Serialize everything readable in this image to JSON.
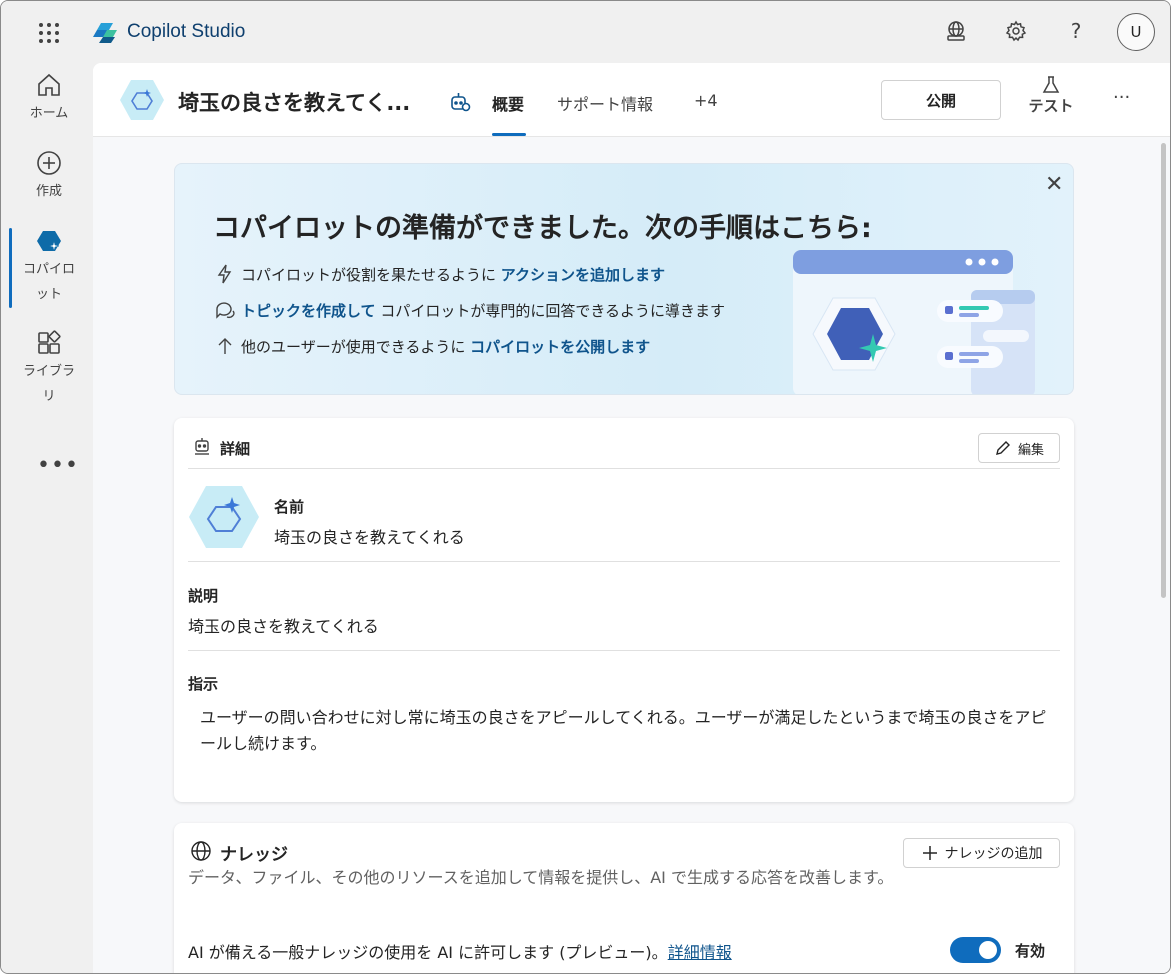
{
  "app": {
    "brand_name": "Copilot Studio",
    "avatar_initial": "U"
  },
  "rail": {
    "items": [
      {
        "label": "ホーム",
        "icon": "home-icon"
      },
      {
        "label": "作成",
        "icon": "add-circle-icon"
      },
      {
        "label": "コパイロット",
        "icon": "copilot-hex-icon",
        "active": true
      },
      {
        "label": "ライブラリ",
        "icon": "library-icon"
      }
    ],
    "more": "•••"
  },
  "header": {
    "title": "埼玉の良さを教えてく...",
    "tabs": [
      {
        "label": "概要",
        "active": true
      },
      {
        "label": "サポート情報"
      },
      {
        "label": "+4"
      }
    ],
    "publish_label": "公開",
    "test_label": "テスト",
    "more": "···"
  },
  "banner": {
    "title": "コパイロットの準備ができました。次の手順はこちら:",
    "steps": [
      {
        "pre": "コパイロットが役割を果たせるように ",
        "link": "アクションを追加します",
        "post": "",
        "icon": "flash-icon"
      },
      {
        "pre": "",
        "link": "トピックを作成して",
        "post": " コパイロットが専門的に回答できるように導きます",
        "icon": "chat-bubbles-icon"
      },
      {
        "pre": "他のユーザーが使用できるように ",
        "link": "コパイロットを公開します",
        "post": "",
        "icon": "arrow-up-icon"
      }
    ]
  },
  "details": {
    "heading": "詳細",
    "edit_label": "編集",
    "name_label": "名前",
    "name_value": "埼玉の良さを教えてくれる",
    "description_label": "説明",
    "description_value": "埼玉の良さを教えてくれる",
    "instructions_label": "指示",
    "instructions_value": "ユーザーの問い合わせに対し常に埼玉の良さをアピールしてくれる。ユーザーが満足したというまで埼玉の良さをアピールし続けます。"
  },
  "knowledge": {
    "heading": "ナレッジ",
    "description": "データ、ファイル、その他のリソースを追加して情報を提供し、AI で生成する応答を改善します。",
    "add_label": "ナレッジの追加",
    "general_text": "AI が備える一般ナレッジの使用を AI に許可します (プレビュー)。",
    "general_link": "詳細情報",
    "toggle_label": "有効",
    "toggle_on": true
  },
  "colors": {
    "accent": "#0f6cbd",
    "link": "#0f548c",
    "banner_bg": "#d5ecf8"
  }
}
